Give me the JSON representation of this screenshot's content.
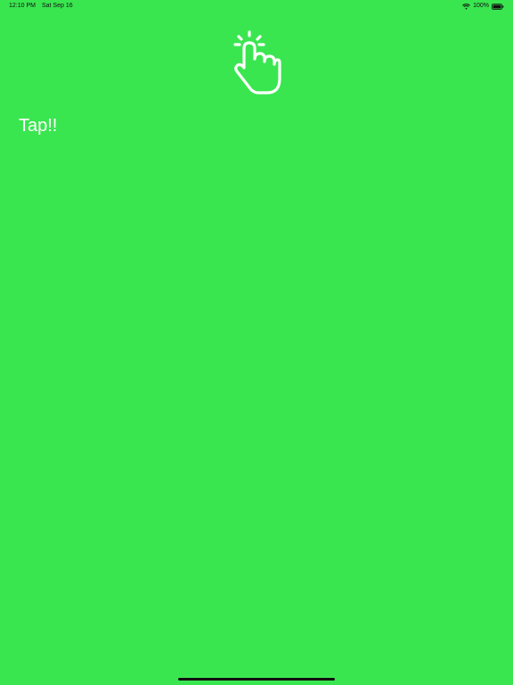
{
  "status_bar": {
    "time": "12:10 PM",
    "date": "Sat Sep 16",
    "battery_percent": "100%",
    "wifi_icon": "wifi-icon",
    "battery_icon": "battery-full-icon"
  },
  "main": {
    "tap_icon": "hand-tap-icon",
    "tap_label": "Tap!!"
  },
  "colors": {
    "background": "#3AE650",
    "foreground": "#FFFFFF"
  }
}
